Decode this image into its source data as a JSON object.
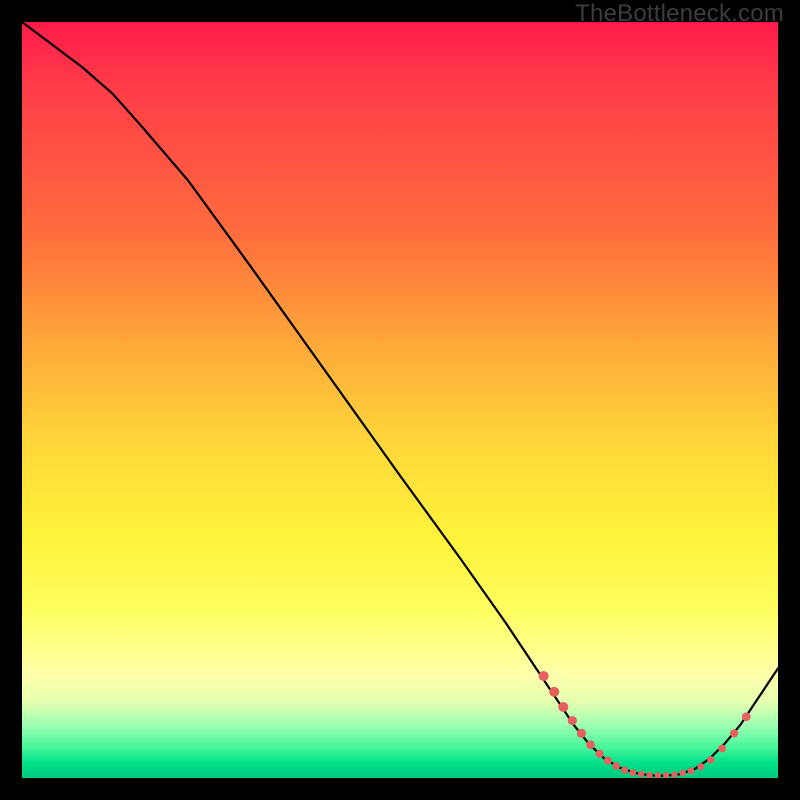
{
  "watermark": "TheBottleneck.com",
  "colors": {
    "page_bg": "#000000",
    "curve": "#000000",
    "marker": "#e5605e",
    "gradient_top": "#ff1a49",
    "gradient_bottom": "#00c97d"
  },
  "chart_data": {
    "type": "line",
    "title": "",
    "xlabel": "",
    "ylabel": "",
    "xlim": [
      0,
      100
    ],
    "ylim": [
      0,
      100
    ],
    "grid": false,
    "curve": [
      {
        "x": 0,
        "y": 100
      },
      {
        "x": 4,
        "y": 97
      },
      {
        "x": 8,
        "y": 94
      },
      {
        "x": 12,
        "y": 90.5
      },
      {
        "x": 16,
        "y": 86
      },
      {
        "x": 22,
        "y": 79
      },
      {
        "x": 30,
        "y": 68
      },
      {
        "x": 40,
        "y": 54
      },
      {
        "x": 50,
        "y": 40
      },
      {
        "x": 58,
        "y": 29
      },
      {
        "x": 64,
        "y": 20.5
      },
      {
        "x": 68,
        "y": 14.5
      },
      {
        "x": 71,
        "y": 10
      },
      {
        "x": 73,
        "y": 7
      },
      {
        "x": 75,
        "y": 4.5
      },
      {
        "x": 77,
        "y": 2.6
      },
      {
        "x": 79,
        "y": 1.4
      },
      {
        "x": 81,
        "y": 0.7
      },
      {
        "x": 83,
        "y": 0.35
      },
      {
        "x": 85,
        "y": 0.3
      },
      {
        "x": 87,
        "y": 0.5
      },
      {
        "x": 89,
        "y": 1.2
      },
      {
        "x": 91,
        "y": 2.6
      },
      {
        "x": 93,
        "y": 4.6
      },
      {
        "x": 95,
        "y": 7
      },
      {
        "x": 97,
        "y": 10
      },
      {
        "x": 100,
        "y": 14.5
      }
    ],
    "markers": [
      {
        "x": 69,
        "y": 13.5,
        "r": 5.0
      },
      {
        "x": 70.4,
        "y": 11.4,
        "r": 5.0
      },
      {
        "x": 71.6,
        "y": 9.4,
        "r": 5.0
      },
      {
        "x": 72.8,
        "y": 7.6,
        "r": 4.6
      },
      {
        "x": 74.0,
        "y": 5.9,
        "r": 4.6
      },
      {
        "x": 75.2,
        "y": 4.4,
        "r": 4.4
      },
      {
        "x": 76.4,
        "y": 3.2,
        "r": 4.2
      },
      {
        "x": 77.5,
        "y": 2.3,
        "r": 4.0
      },
      {
        "x": 78.6,
        "y": 1.6,
        "r": 3.8
      },
      {
        "x": 79.7,
        "y": 1.05,
        "r": 3.6
      },
      {
        "x": 80.8,
        "y": 0.7,
        "r": 3.4
      },
      {
        "x": 81.9,
        "y": 0.5,
        "r": 3.3
      },
      {
        "x": 83.0,
        "y": 0.38,
        "r": 3.2
      },
      {
        "x": 84.1,
        "y": 0.33,
        "r": 3.2
      },
      {
        "x": 85.2,
        "y": 0.35,
        "r": 3.2
      },
      {
        "x": 86.3,
        "y": 0.45,
        "r": 3.2
      },
      {
        "x": 87.4,
        "y": 0.65,
        "r": 3.3
      },
      {
        "x": 88.5,
        "y": 0.95,
        "r": 3.4
      },
      {
        "x": 89.8,
        "y": 1.5,
        "r": 3.5
      },
      {
        "x": 91.1,
        "y": 2.4,
        "r": 3.7
      },
      {
        "x": 92.6,
        "y": 3.9,
        "r": 3.9
      },
      {
        "x": 94.2,
        "y": 5.9,
        "r": 4.1
      },
      {
        "x": 95.8,
        "y": 8.1,
        "r": 4.4
      }
    ]
  }
}
